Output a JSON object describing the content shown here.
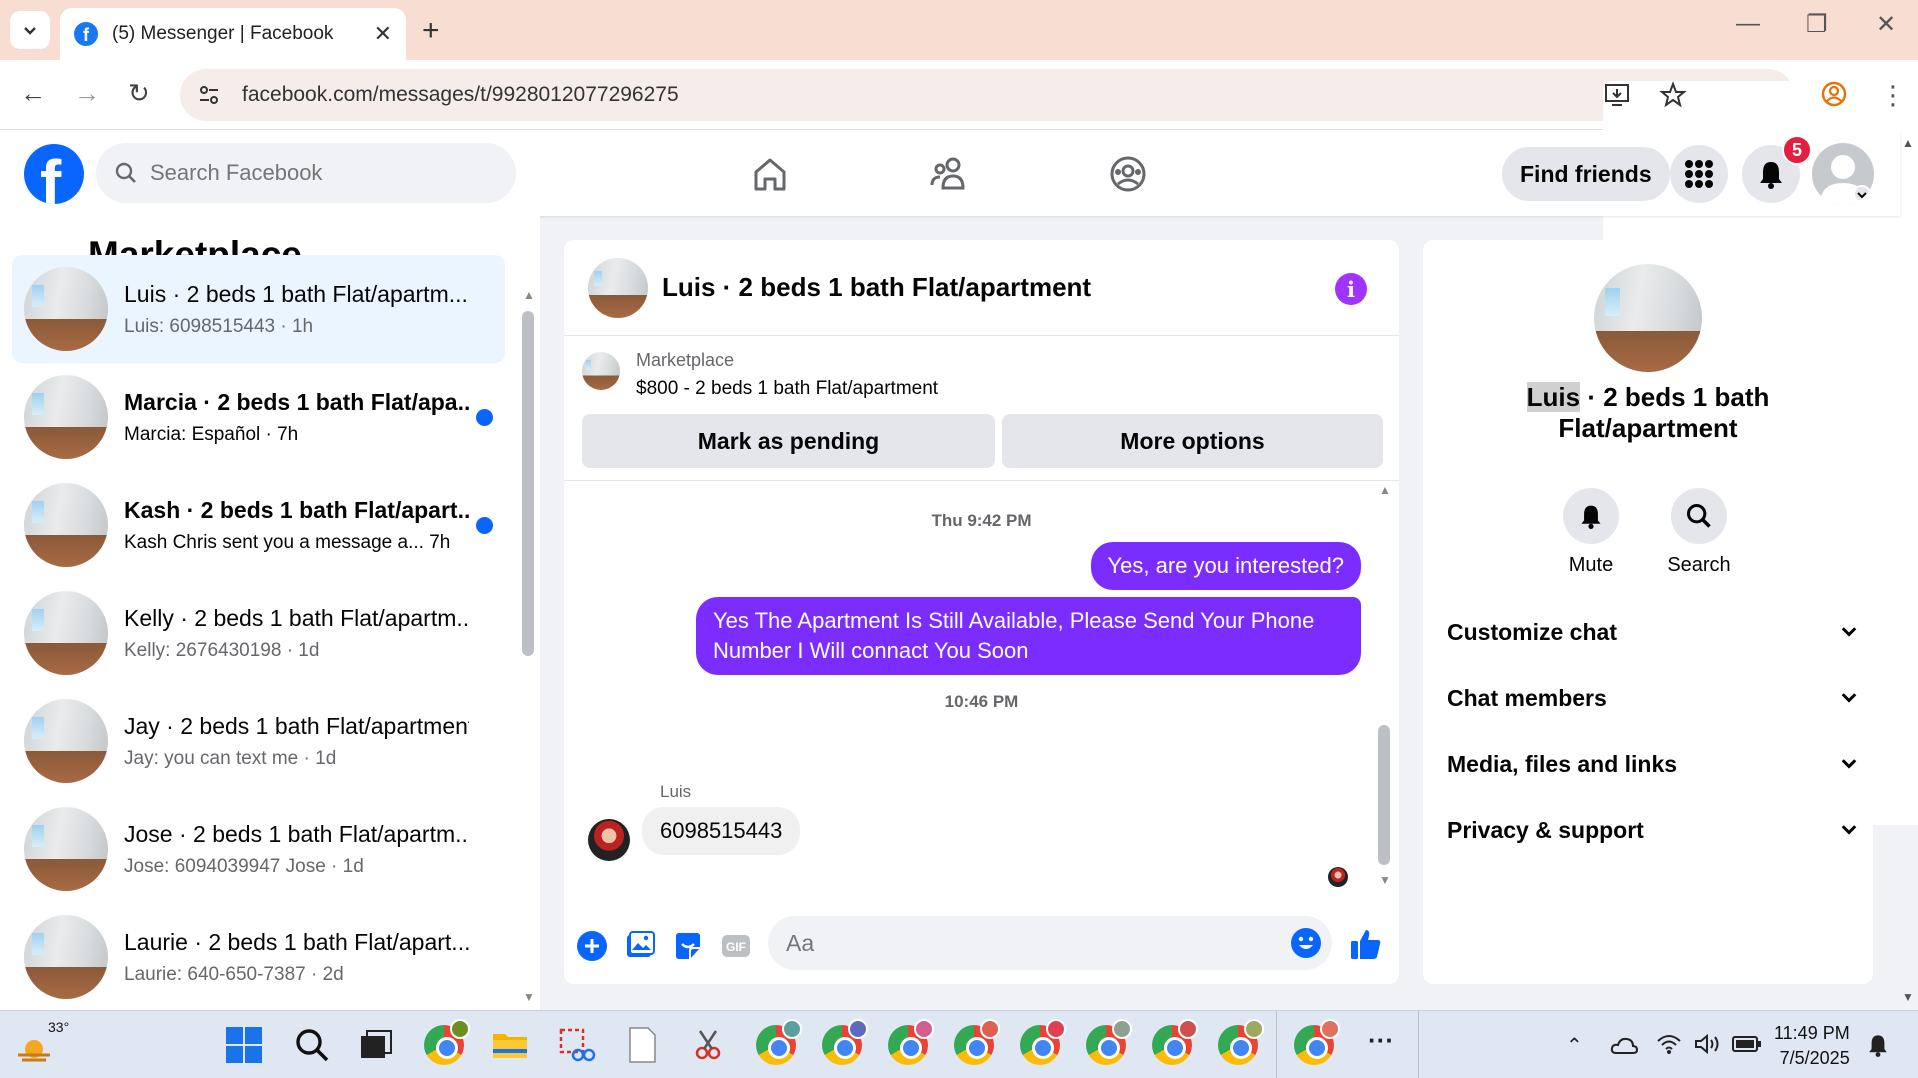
{
  "browser": {
    "tab_title": "(5) Messenger | Facebook",
    "url": "facebook.com/messages/t/9928012077296275"
  },
  "fb_header": {
    "search_placeholder": "Search Facebook",
    "find_friends": "Find friends",
    "notification_count": "5"
  },
  "left_panel": {
    "title": "Marketplace",
    "conversations": [
      {
        "name": "Luis · 2 beds 1 bath Flat/apartm...",
        "preview": "Luis: 6098515443 · 1h",
        "active": true,
        "unread": false
      },
      {
        "name": "Marcia · 2 beds 1 bath Flat/apa...",
        "preview": "Marcia: Español · 7h",
        "active": false,
        "unread": true
      },
      {
        "name": "Kash · 2 beds 1 bath Flat/apart...",
        "preview": "Kash Chris sent you a message a... 7h",
        "active": false,
        "unread": true
      },
      {
        "name": "Kelly · 2 beds 1 bath Flat/apartm...",
        "preview": "Kelly: 2676430198 · 1d",
        "active": false,
        "unread": false
      },
      {
        "name": "Jay · 2 beds 1 bath Flat/apartment",
        "preview": "Jay: you can text me · 1d",
        "active": false,
        "unread": false
      },
      {
        "name": "Jose · 2 beds 1 bath Flat/apartm...",
        "preview": "Jose: 6094039947 Jose · 1d",
        "active": false,
        "unread": false
      },
      {
        "name": "Laurie · 2 beds 1 bath Flat/apart...",
        "preview": "Laurie: 640-650-7387 · 2d",
        "active": false,
        "unread": false
      }
    ]
  },
  "chat": {
    "title": "Luis · 2 beds 1 bath Flat/apartment",
    "marketplace_label": "Marketplace",
    "listing": "$800 - 2 beds 1 bath Flat/apartment",
    "mark_pending": "Mark as pending",
    "more_options": "More options",
    "timestamp_1": "Thu 9:42 PM",
    "msg_out_1": "Yes, are you interested?",
    "msg_out_2_line1": "Yes The Apartment Is Still Available, Please Send Your Phone",
    "msg_out_2_line2": "Number I Will connact You Soon",
    "timestamp_2": "10:46 PM",
    "sender": "Luis",
    "msg_in_1": "6098515443",
    "composer_placeholder": "Aa"
  },
  "right_panel": {
    "name_first": "Luis",
    "name_rest": " · 2 beds 1 bath",
    "name_line2": "Flat/apartment",
    "mute": "Mute",
    "search": "Search",
    "sections": [
      "Customize chat",
      "Chat members",
      "Media, files and links",
      "Privacy & support"
    ]
  },
  "taskbar": {
    "temperature": "33°",
    "time": "11:49 PM",
    "date": "7/5/2025"
  },
  "colors": {
    "accent": "#7b2cff",
    "fb_blue": "#0866ff",
    "badge_red": "#e41e3f",
    "info_purple": "#a033ff"
  }
}
